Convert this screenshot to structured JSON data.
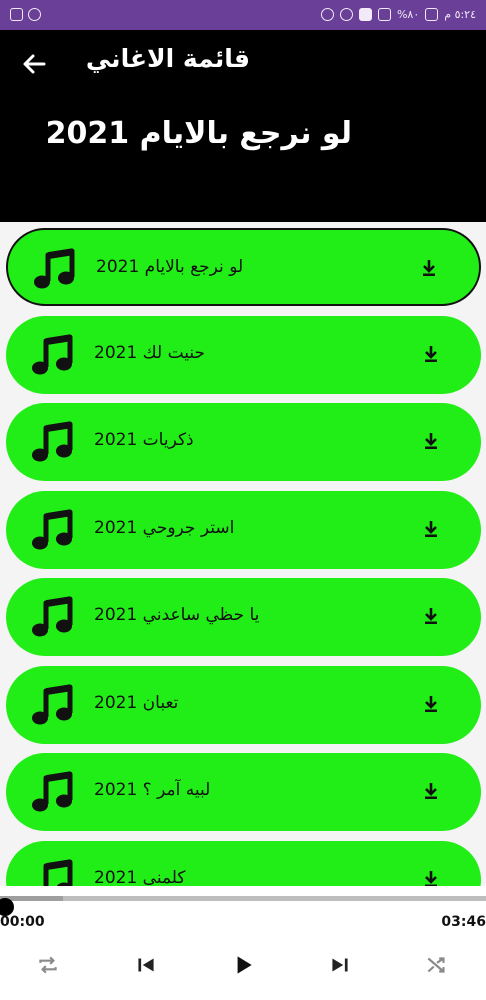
{
  "status_bar": {
    "time": "٥:٢٤ م",
    "battery": "%٨٠"
  },
  "header": {
    "app_title": "قائمة الاغاني",
    "song_title": "لو نرجع بالايام 2021"
  },
  "songs": [
    {
      "title": "لو نرجع بالايام 2021",
      "active": true
    },
    {
      "title": "حنيت لك 2021",
      "active": false
    },
    {
      "title": "ذكريات 2021",
      "active": false
    },
    {
      "title": "استر جروحي 2021",
      "active": false
    },
    {
      "title": "يا حظي ساعدني 2021",
      "active": false
    },
    {
      "title": "تعبان 2021",
      "active": false
    },
    {
      "title": "لبيه آمر ؟ 2021",
      "active": false
    },
    {
      "title": "كلمني 2021",
      "active": false
    }
  ],
  "player": {
    "current_time": "00:00",
    "total_time": "03:46",
    "progress": 0.0,
    "buffered": 0.13
  },
  "icons": {
    "back": "arrow-left-icon",
    "note": "music-note-icon",
    "download": "download-icon",
    "repeat": "repeat-icon",
    "previous": "skip-previous-icon",
    "play": "play-icon",
    "next": "skip-next-icon",
    "shuffle": "shuffle-icon"
  },
  "colors": {
    "status_bar": "#6a3f97",
    "header": "#000000",
    "item": "#22ee17"
  }
}
